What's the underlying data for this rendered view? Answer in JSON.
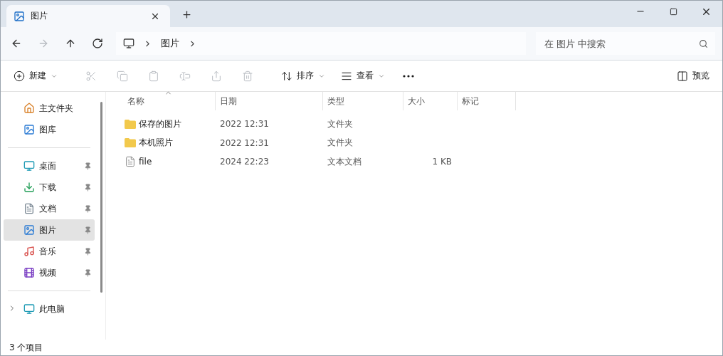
{
  "tabs": [
    {
      "title": "图片",
      "selected": true
    }
  ],
  "nav_buttons": [
    {
      "kind": "back",
      "disabled": false
    },
    {
      "kind": "forward",
      "disabled": true
    },
    {
      "kind": "up",
      "disabled": false
    },
    {
      "kind": "refresh",
      "disabled": false
    }
  ],
  "address": {
    "segments": [
      "图片"
    ]
  },
  "search": {
    "placeholder": "在 图片 中搜索"
  },
  "commands": [
    {
      "kind": "new",
      "label": "新建",
      "disabled": false
    },
    {
      "kind": "cut",
      "disabled": true
    },
    {
      "kind": "copy",
      "disabled": true
    },
    {
      "kind": "paste",
      "disabled": true
    },
    {
      "kind": "rename",
      "disabled": true
    },
    {
      "kind": "share",
      "disabled": true
    },
    {
      "kind": "delete",
      "disabled": true
    },
    {
      "kind": "sort",
      "label": "排序",
      "disabled": false
    },
    {
      "kind": "view",
      "label": "查看",
      "disabled": false
    },
    {
      "kind": "more",
      "disabled": false
    }
  ],
  "preview_button": {
    "label": "预览"
  },
  "sidebar": {
    "groups": [
      [
        {
          "kind": "home",
          "label": "主文件夹",
          "pinned": false,
          "selected": false,
          "expandable": false
        },
        {
          "kind": "gallery",
          "label": "图库",
          "pinned": false,
          "selected": false,
          "expandable": false
        }
      ],
      [
        {
          "kind": "desktop",
          "label": "桌面",
          "pinned": true,
          "selected": false,
          "expandable": false
        },
        {
          "kind": "downloads",
          "label": "下载",
          "pinned": true,
          "selected": false,
          "expandable": false
        },
        {
          "kind": "documents",
          "label": "文档",
          "pinned": true,
          "selected": false,
          "expandable": false
        },
        {
          "kind": "pictures",
          "label": "图片",
          "pinned": true,
          "selected": true,
          "expandable": false
        },
        {
          "kind": "music",
          "label": "音乐",
          "pinned": true,
          "selected": false,
          "expandable": false
        },
        {
          "kind": "videos",
          "label": "视频",
          "pinned": true,
          "selected": false,
          "expandable": false
        }
      ],
      [
        {
          "kind": "pc",
          "label": "此电脑",
          "pinned": false,
          "selected": false,
          "expandable": true
        }
      ]
    ]
  },
  "columns": [
    "名称",
    "日期",
    "类型",
    "大小",
    "标记"
  ],
  "rows": [
    {
      "kind": "folder",
      "name": "保存的图片",
      "date": "2022 12:31",
      "type": "文件夹"
    },
    {
      "kind": "folder",
      "name": "本机照片",
      "date": "2022 12:31",
      "type": "文件夹"
    },
    {
      "kind": "file",
      "name": "file",
      "date": "2024 22:23",
      "type": "文本文档",
      "size": "1 KB"
    }
  ],
  "status_bar": "3 个项目"
}
